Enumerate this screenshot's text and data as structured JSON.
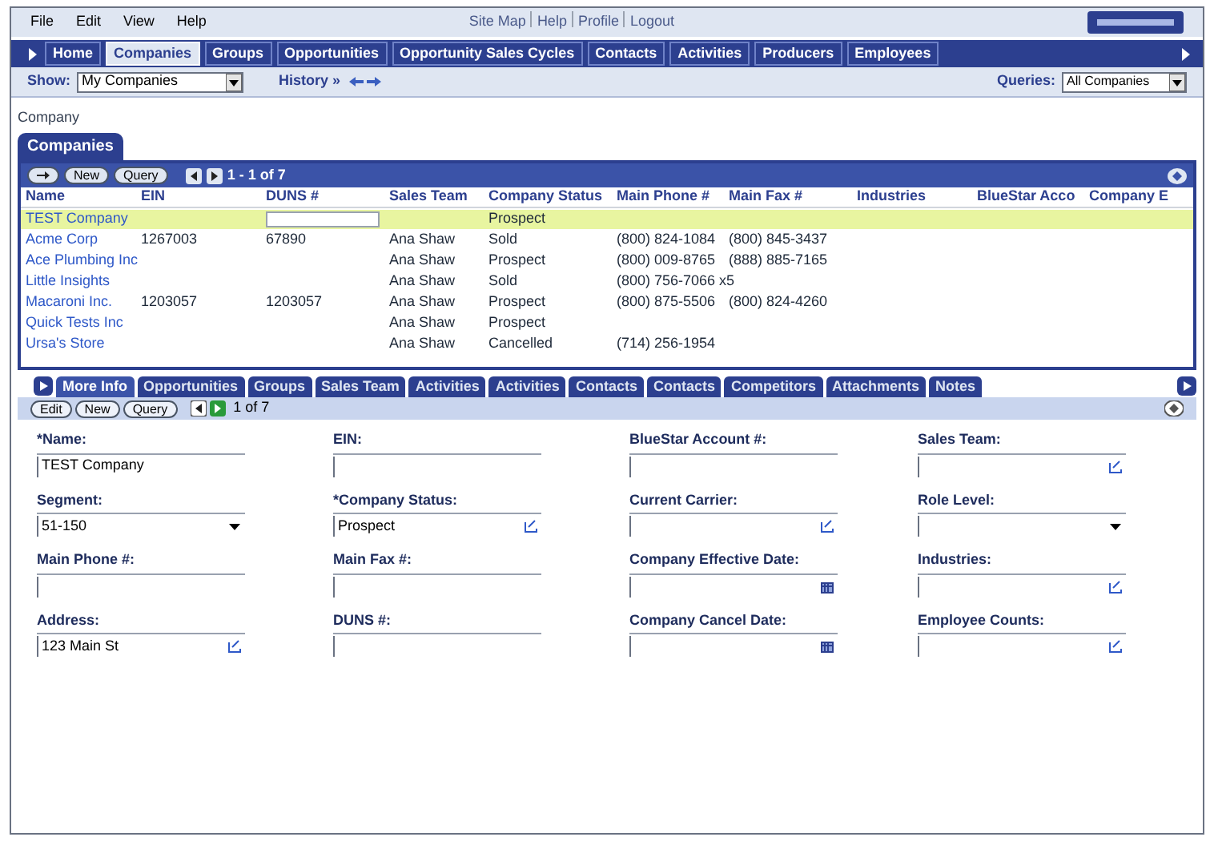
{
  "menu": [
    "File",
    "Edit",
    "View",
    "Help"
  ],
  "top_links": [
    "Site Map",
    "Help",
    "Profile",
    "Logout"
  ],
  "nav_tabs": [
    {
      "label": "Home",
      "selected": false
    },
    {
      "label": "Companies",
      "selected": true
    },
    {
      "label": "Groups",
      "selected": false
    },
    {
      "label": "Opportunities",
      "selected": false
    },
    {
      "label": "Opportunity Sales Cycles",
      "selected": false
    },
    {
      "label": "Contacts",
      "selected": false
    },
    {
      "label": "Activities",
      "selected": false
    },
    {
      "label": "Producers",
      "selected": false
    },
    {
      "label": "Employees",
      "selected": false
    }
  ],
  "toolbar": {
    "show_label": "Show:",
    "show_value": "My Companies",
    "history_label": "History »",
    "queries_label": "Queries:",
    "queries_value": "All Companies"
  },
  "breadcrumb": "Company",
  "list_panel": {
    "title": "Companies",
    "buttons": [
      "New",
      "Query"
    ],
    "pager": "1 - 1 of 7",
    "columns": [
      "Name",
      "EIN",
      "DUNS #",
      "Sales Team",
      "Company Status",
      "Main Phone #",
      "Main Fax #",
      "Industries",
      "BlueStar Acco",
      "Company E"
    ],
    "rows": [
      {
        "selected": true,
        "cells": [
          "TEST Company",
          "",
          "",
          "",
          "Prospect",
          "",
          "",
          "",
          "",
          ""
        ]
      },
      {
        "selected": false,
        "cells": [
          "Acme Corp",
          "1267003",
          "67890",
          "Ana Shaw",
          "Sold",
          "(800) 824-1084",
          "(800) 845-3437",
          "",
          "",
          ""
        ]
      },
      {
        "selected": false,
        "cells": [
          "Ace Plumbing Inc",
          "",
          "",
          "Ana Shaw",
          "Prospect",
          "(800) 009-8765",
          "(888) 885-7165",
          "",
          "",
          ""
        ]
      },
      {
        "selected": false,
        "cells": [
          "Little Insights",
          "",
          "",
          "Ana Shaw",
          "Sold",
          "(800) 756-7066 x5",
          "",
          "",
          "",
          ""
        ]
      },
      {
        "selected": false,
        "cells": [
          "Macaroni Inc.",
          "1203057",
          "1203057",
          "Ana Shaw",
          "Prospect",
          "(800) 875-5506",
          "(800) 824-4260",
          "",
          "",
          ""
        ]
      },
      {
        "selected": false,
        "cells": [
          "Quick Tests Inc",
          "",
          "",
          "Ana Shaw",
          "Prospect",
          "",
          "",
          "",
          "",
          ""
        ]
      },
      {
        "selected": false,
        "cells": [
          "Ursa's Store",
          "",
          "",
          "Ana Shaw",
          "Cancelled",
          "(714) 256-1954",
          "",
          "",
          "",
          ""
        ]
      }
    ]
  },
  "detail_tabs": [
    {
      "label": "More Info",
      "selected": true
    },
    {
      "label": "Opportunities",
      "selected": false
    },
    {
      "label": "Groups",
      "selected": false
    },
    {
      "label": "Sales Team",
      "selected": false
    },
    {
      "label": "Activities",
      "selected": false
    },
    {
      "label": "Activities",
      "selected": false
    },
    {
      "label": "Contacts",
      "selected": false
    },
    {
      "label": "Contacts",
      "selected": false
    },
    {
      "label": "Competitors",
      "selected": false
    },
    {
      "label": "Attachments",
      "selected": false
    },
    {
      "label": "Notes",
      "selected": false
    }
  ],
  "detail_toolbar": {
    "buttons": [
      "Edit",
      "New",
      "Query"
    ],
    "pager": "1 of 7"
  },
  "form_columns": [
    [
      {
        "label": "*Name:",
        "value": "TEST Company",
        "kind": "text"
      },
      {
        "label": "Segment:",
        "value": "51-150",
        "kind": "select"
      },
      {
        "label": "Main Phone #:",
        "kind": "text"
      },
      {
        "label": "Address:",
        "value": "123 Main St",
        "kind": "lookup"
      }
    ],
    [
      {
        "label": "EIN:",
        "kind": "text"
      },
      {
        "label": "*Company Status:",
        "value": "Prospect",
        "kind": "lookup"
      },
      {
        "label": "Main Fax #:",
        "kind": "text"
      },
      {
        "label": "DUNS #:",
        "kind": "text"
      }
    ],
    [
      {
        "label": "BlueStar Account #:",
        "kind": "text"
      },
      {
        "label": "Current Carrier:",
        "kind": "lookup"
      },
      {
        "label": "Company Effective Date:",
        "kind": "date"
      },
      {
        "label": "Company Cancel Date:",
        "kind": "date"
      }
    ],
    [
      {
        "label": "Sales Team:",
        "kind": "lookup"
      },
      {
        "label": "Role Level:",
        "kind": "select"
      },
      {
        "label": "Industries:",
        "kind": "lookup"
      },
      {
        "label": "Employee Counts:",
        "kind": "lookup"
      }
    ]
  ]
}
